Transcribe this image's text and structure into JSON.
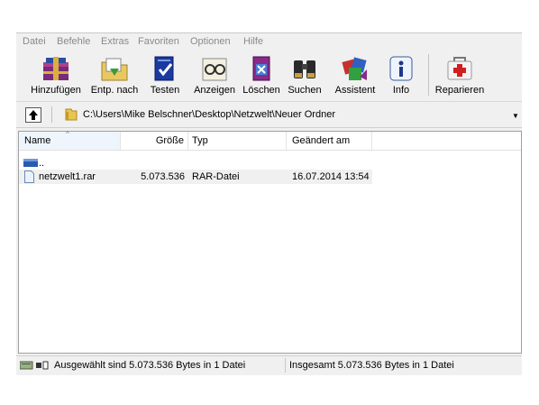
{
  "menu": [
    "Datei",
    "Befehle",
    "Extras",
    "Favoriten",
    "Optionen",
    "Hilfe"
  ],
  "toolbar": {
    "buttons": [
      {
        "label": "Hinzufügen",
        "icon": "books-add-icon"
      },
      {
        "label": "Entp. nach",
        "icon": "extract-folder-icon"
      },
      {
        "label": "Testen",
        "icon": "test-book-icon"
      },
      {
        "label": "Anzeigen",
        "icon": "glasses-view-icon"
      },
      {
        "label": "Löschen",
        "icon": "delete-book-icon"
      },
      {
        "label": "Suchen",
        "icon": "binoculars-icon"
      },
      {
        "label": "Assistent",
        "icon": "wizard-icon"
      },
      {
        "label": "Info",
        "icon": "info-icon"
      },
      {
        "label": "Reparieren",
        "icon": "first-aid-kit-icon"
      }
    ]
  },
  "address": {
    "path": "C:\\Users\\Mike Belschner\\Desktop\\Netzwelt\\Neuer Ordner"
  },
  "columns": {
    "name": "Name",
    "size": "Größe",
    "type": "Typ",
    "modified": "Geändert am"
  },
  "rows": [
    {
      "name": "..",
      "size": "",
      "type": "",
      "modified": ""
    },
    {
      "name": "netzwelt1.rar",
      "size": "5.073.536",
      "type": "RAR-Datei",
      "modified": "16.07.2014 13:54"
    }
  ],
  "status": {
    "left": "Ausgewählt sind 5.073.536 Bytes in 1 Datei",
    "right": "Insgesamt 5.073.536 Bytes in 1 Datei"
  },
  "colors": {
    "window_bg": "#f0f0f0",
    "selected_row": "#f0f0f0",
    "menu_text": "#8a8a8a"
  }
}
